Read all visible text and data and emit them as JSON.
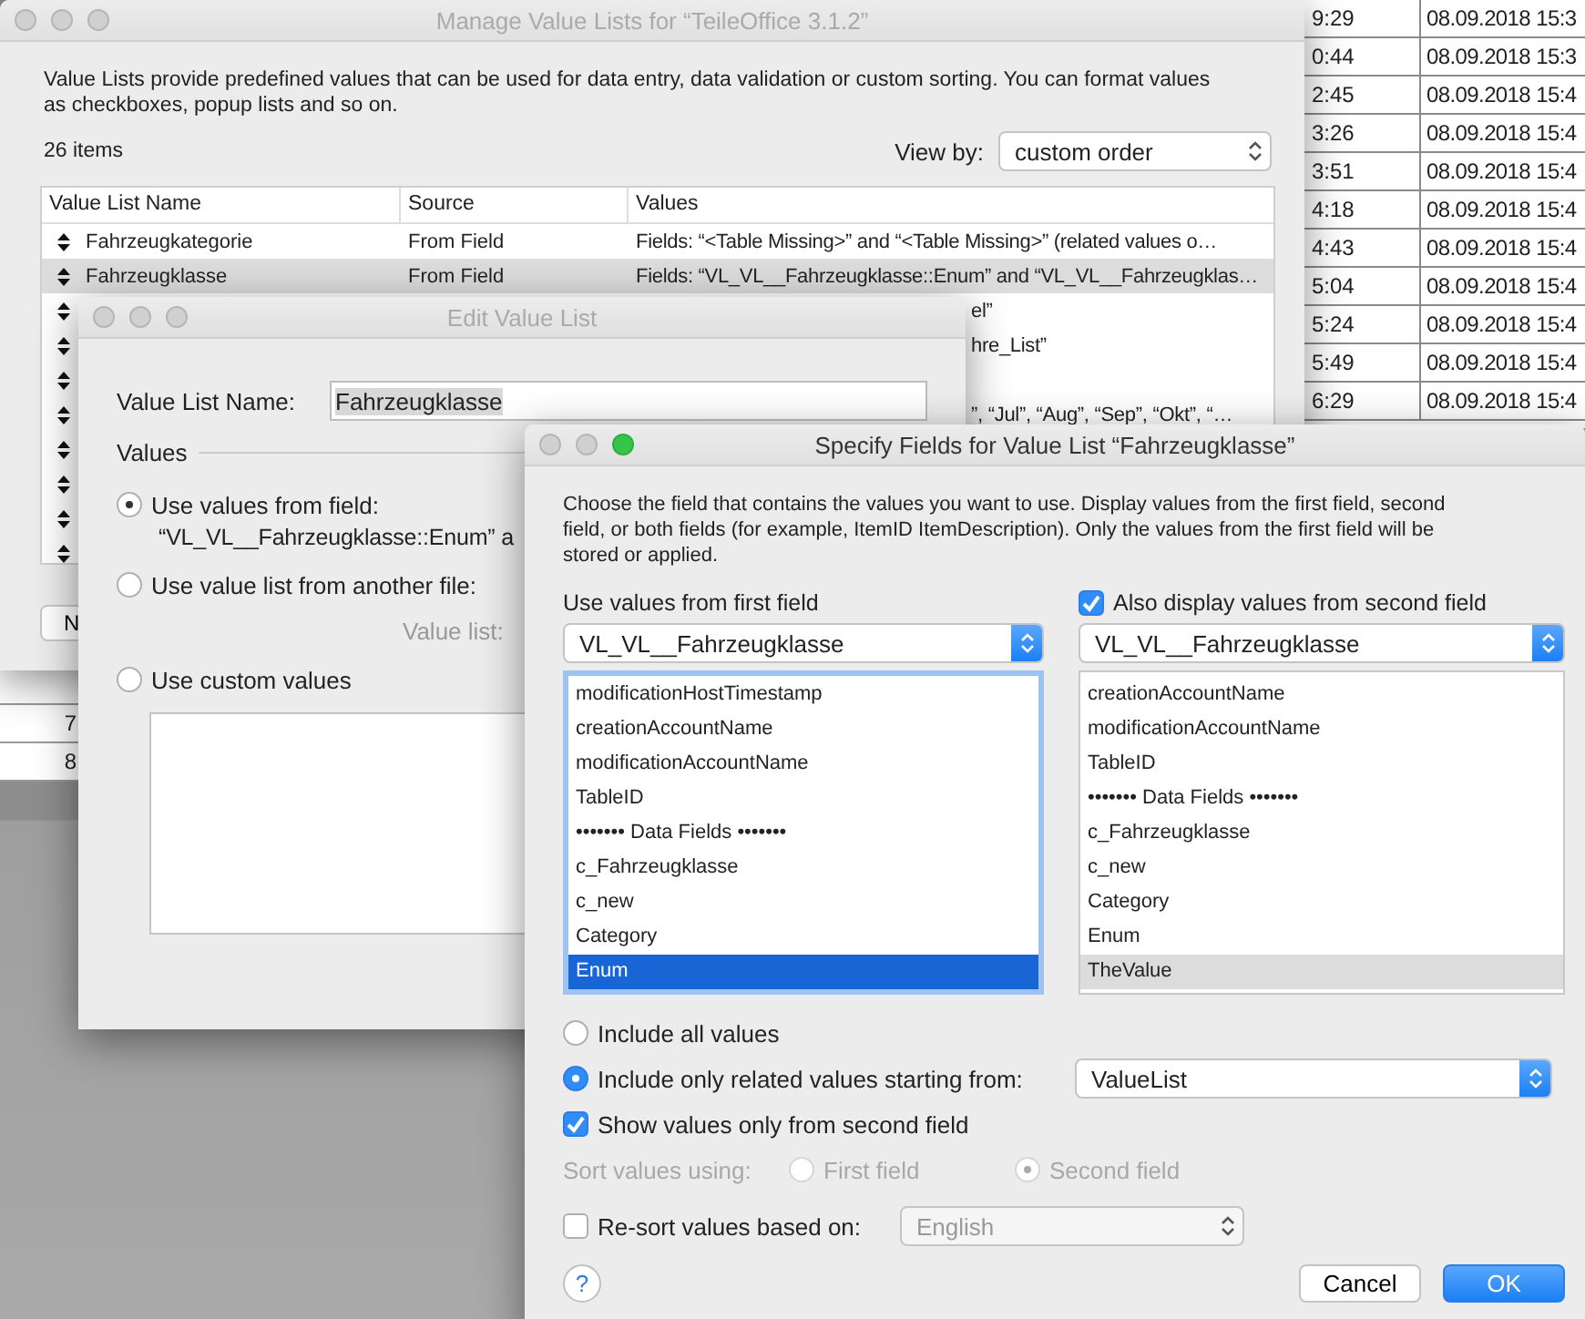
{
  "spreadsheet": {
    "right_rows": [
      {
        "time": "9:29",
        "date": "08.09.2018 15:3"
      },
      {
        "time": "0:44",
        "date": "08.09.2018 15:3"
      },
      {
        "time": "2:45",
        "date": "08.09.2018 15:4"
      },
      {
        "time": "3:26",
        "date": "08.09.2018 15:4"
      },
      {
        "time": "3:51",
        "date": "08.09.2018 15:4"
      },
      {
        "time": "4:18",
        "date": "08.09.2018 15:4"
      },
      {
        "time": "4:43",
        "date": "08.09.2018 15:4"
      },
      {
        "time": "5:04",
        "date": "08.09.2018 15:4"
      },
      {
        "time": "5:24",
        "date": "08.09.2018 15:4"
      },
      {
        "time": "5:49",
        "date": "08.09.2018 15:4"
      },
      {
        "time": "6:29",
        "date": "08.09.2018 15:4"
      }
    ],
    "left_rows": [
      "7",
      "8"
    ]
  },
  "manage_window": {
    "title": "Manage Value Lists for “TeileOffice 3.1.2”",
    "active": false,
    "description": "Value Lists provide predefined values that can be used for data entry, data validation or custom sorting. You can format values as checkboxes, popup lists and so on.",
    "item_count": "26 items",
    "view_by": {
      "label": "View by:",
      "value": "custom order"
    },
    "columns": [
      "Value List Name",
      "Source",
      "Values"
    ],
    "rows": [
      {
        "name": "Fahrzeugkategorie",
        "source": "From Field",
        "values": "Fields: “<Table Missing>” and “<Table Missing>” (related values o…",
        "selected": false
      },
      {
        "name": "Fahrzeugklasse",
        "source": "From Field",
        "values": "Fields: “VL_VL__Fahrzeugklasse::Enum” and “VL_VL__Fahrzeugklas…",
        "selected": true
      },
      {
        "values": "el”",
        "selected": false
      },
      {
        "values": "hre_List”",
        "selected": false
      },
      {
        "selected": false
      },
      {
        "values": "”, “Jul”, “Aug”, “Sep”, “Okt”, “…",
        "selected": false
      },
      {
        "selected": false
      },
      {
        "selected": false
      },
      {
        "selected": false
      },
      {
        "selected": false
      }
    ],
    "button": "N"
  },
  "edit_window": {
    "title": "Edit Value List",
    "active": false,
    "name_label": "Value List Name:",
    "name_value": "Fahrzeugklasse",
    "section": "Values",
    "options": [
      {
        "label": "Use values from field:",
        "selected": true,
        "detail": "“VL_VL__Fahrzeugklasse::Enum” a"
      },
      {
        "label": "Use value list from another file:",
        "selected": false,
        "sub_label": "Value list:"
      },
      {
        "label": "Use custom values",
        "selected": false
      }
    ]
  },
  "specify_window": {
    "title": "Specify Fields for Value List “Fahrzeugklasse”",
    "active": true,
    "description": "Choose the field that contains the values you want to use.  Display values from the first field, second field, or both fields (for example, ItemID ItemDescription). Only the values from the first field will be stored or applied.",
    "first": {
      "label": "Use values from first field",
      "table": "VL_VL__Fahrzeugklasse",
      "fields": [
        {
          "name": "modificationHostTimestamp",
          "selected": false
        },
        {
          "name": "creationAccountName",
          "selected": false
        },
        {
          "name": "modificationAccountName",
          "selected": false
        },
        {
          "name": "TableID",
          "selected": false
        },
        {
          "name": "•••••••  Data Fields  •••••••",
          "selected": false
        },
        {
          "name": "c_Fahrzeugklasse",
          "selected": false
        },
        {
          "name": "c_new",
          "selected": false
        },
        {
          "name": "Category",
          "selected": false
        },
        {
          "name": "Enum",
          "selected": true
        }
      ]
    },
    "second": {
      "label": "Also display values from second field",
      "checked": true,
      "table": "VL_VL__Fahrzeugklasse",
      "fields": [
        {
          "name": "creationAccountName",
          "selected": false
        },
        {
          "name": "modificationAccountName",
          "selected": false
        },
        {
          "name": "TableID",
          "selected": false
        },
        {
          "name": "•••••••  Data Fields  •••••••",
          "selected": false
        },
        {
          "name": "c_Fahrzeugklasse",
          "selected": false
        },
        {
          "name": "c_new",
          "selected": false
        },
        {
          "name": "Category",
          "selected": false
        },
        {
          "name": "Enum",
          "selected": false
        },
        {
          "name": "TheValue",
          "selected": true
        }
      ]
    },
    "include": [
      {
        "label": "Include all values",
        "selected": false
      },
      {
        "label": "Include only related values starting from:",
        "selected": true,
        "popup": "ValueList"
      }
    ],
    "show_second_only": {
      "label": "Show values only from second field",
      "checked": true
    },
    "sort": {
      "label": "Sort values using:",
      "disabled": true,
      "options": [
        {
          "label": "First field",
          "selected": false
        },
        {
          "label": "Second field",
          "selected": true
        }
      ]
    },
    "resort": {
      "label": "Re-sort values based on:",
      "checked": false,
      "popup": "English",
      "popup_disabled": true
    },
    "help": "?",
    "buttons": [
      {
        "label": "Cancel",
        "kind": "normal"
      },
      {
        "label": "OK",
        "kind": "default"
      }
    ]
  }
}
